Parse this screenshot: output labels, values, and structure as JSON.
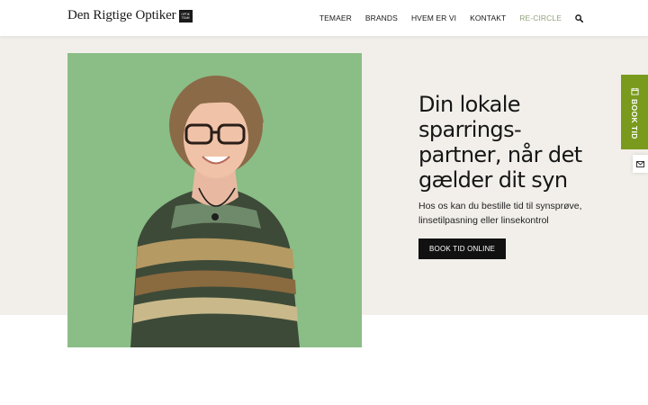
{
  "header": {
    "logo_text": "Den Rigtige Optiker",
    "logo_badge_line1": "OPTIK",
    "logo_badge_line2": "TEAM"
  },
  "nav": {
    "items": [
      {
        "label": "TEMAER"
      },
      {
        "label": "BRANDS"
      },
      {
        "label": "HVEM ER VI"
      },
      {
        "label": "KONTAKT"
      },
      {
        "label": "RE-CIRCLE",
        "color": "#8fa37a"
      }
    ],
    "search_icon": "search-icon"
  },
  "hero": {
    "title": "Din lokale sparrings-partner, når det gælder dit syn",
    "subtitle": "Hos os kan du bestille tid til synsprøve, linsetilpasning eller linsekontrol",
    "cta_label": "BOOK TID ONLINE",
    "background_color": "#f2efea",
    "photo_background_color": "#8bbd86"
  },
  "side_widgets": {
    "book_label": "BOOK TID",
    "book_color": "#7a9a1e",
    "book_icon": "calendar-icon",
    "mail_icon": "mail-icon"
  }
}
